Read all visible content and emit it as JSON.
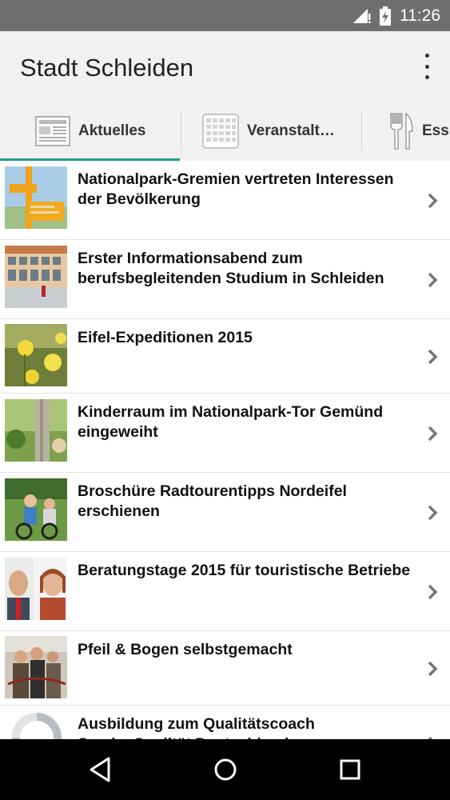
{
  "status_bar": {
    "time": "11:26",
    "icons": [
      "signal-icon",
      "battery-charging-icon"
    ]
  },
  "app_bar": {
    "title": "Stadt Schleiden",
    "menu_icon": "overflow-menu-icon"
  },
  "tabs": [
    {
      "label": "Aktuelles",
      "icon": "newspaper-icon",
      "selected": true
    },
    {
      "label": "Veranstalt…",
      "icon": "calendar-icon",
      "selected": false
    },
    {
      "label": "Ess",
      "icon": "fork-knife-icon",
      "selected": false
    }
  ],
  "colors": {
    "accent": "#1f9d8a",
    "status_bar": "#6f6f6f",
    "app_bar": "#f1f1f1"
  },
  "news": [
    {
      "title": "Nationalpark-Gremien vertreten Interessen der Bevölkerung"
    },
    {
      "title": "Erster Informationsabend zum berufsbegleitenden Studium in Schleiden"
    },
    {
      "title": "Eifel-Expeditionen 2015"
    },
    {
      "title": "Kinderraum im Nationalpark-Tor Gemünd eingeweiht"
    },
    {
      "title": "Broschüre Radtourentipps Nordeifel erschienen"
    },
    {
      "title": "Beratungstage 2015 für touristische Betriebe"
    },
    {
      "title": "Pfeil & Bogen selbstgemacht"
    },
    {
      "title": "Ausbildung zum Qualitätscoach ServiceQualität Deutschland"
    }
  ],
  "nav_bar": {
    "icons": [
      "back-icon",
      "home-icon",
      "recents-icon"
    ]
  }
}
